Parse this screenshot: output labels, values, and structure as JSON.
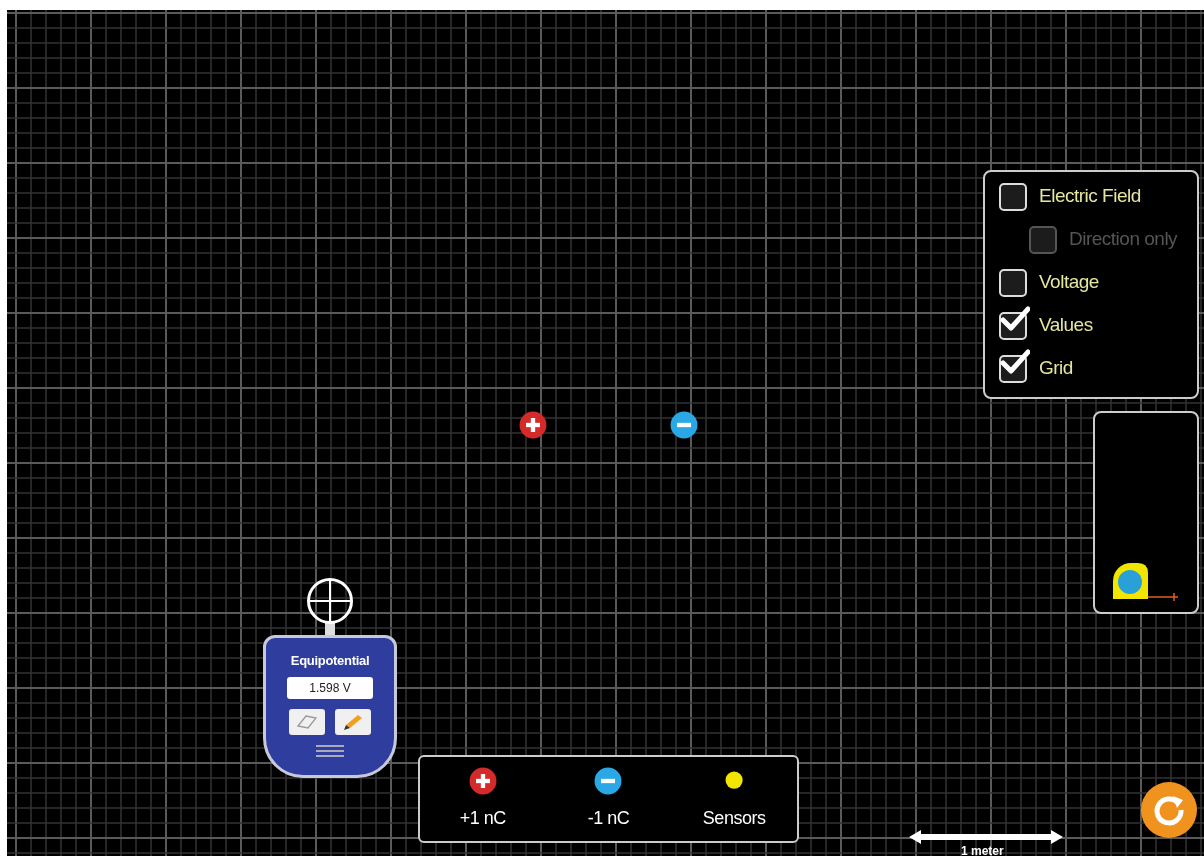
{
  "controls": [
    {
      "label": "Electric Field",
      "checked": false,
      "disabled": false,
      "children": [
        {
          "label": "Direction only",
          "checked": false,
          "disabled": true
        }
      ]
    },
    {
      "label": "Voltage",
      "checked": false,
      "disabled": false
    },
    {
      "label": "Values",
      "checked": true,
      "disabled": false
    },
    {
      "label": "Grid",
      "checked": true,
      "disabled": false
    }
  ],
  "sensor": {
    "title": "Equipotential",
    "value": "1.598 V"
  },
  "toolbox": [
    {
      "kind": "positive",
      "label": "+1 nC"
    },
    {
      "kind": "negative",
      "label": "-1 nC"
    },
    {
      "kind": "sensor",
      "label": "Sensors"
    }
  ],
  "charges": [
    {
      "kind": "positive"
    },
    {
      "kind": "negative"
    }
  ],
  "scale": {
    "label": "1 meter"
  }
}
